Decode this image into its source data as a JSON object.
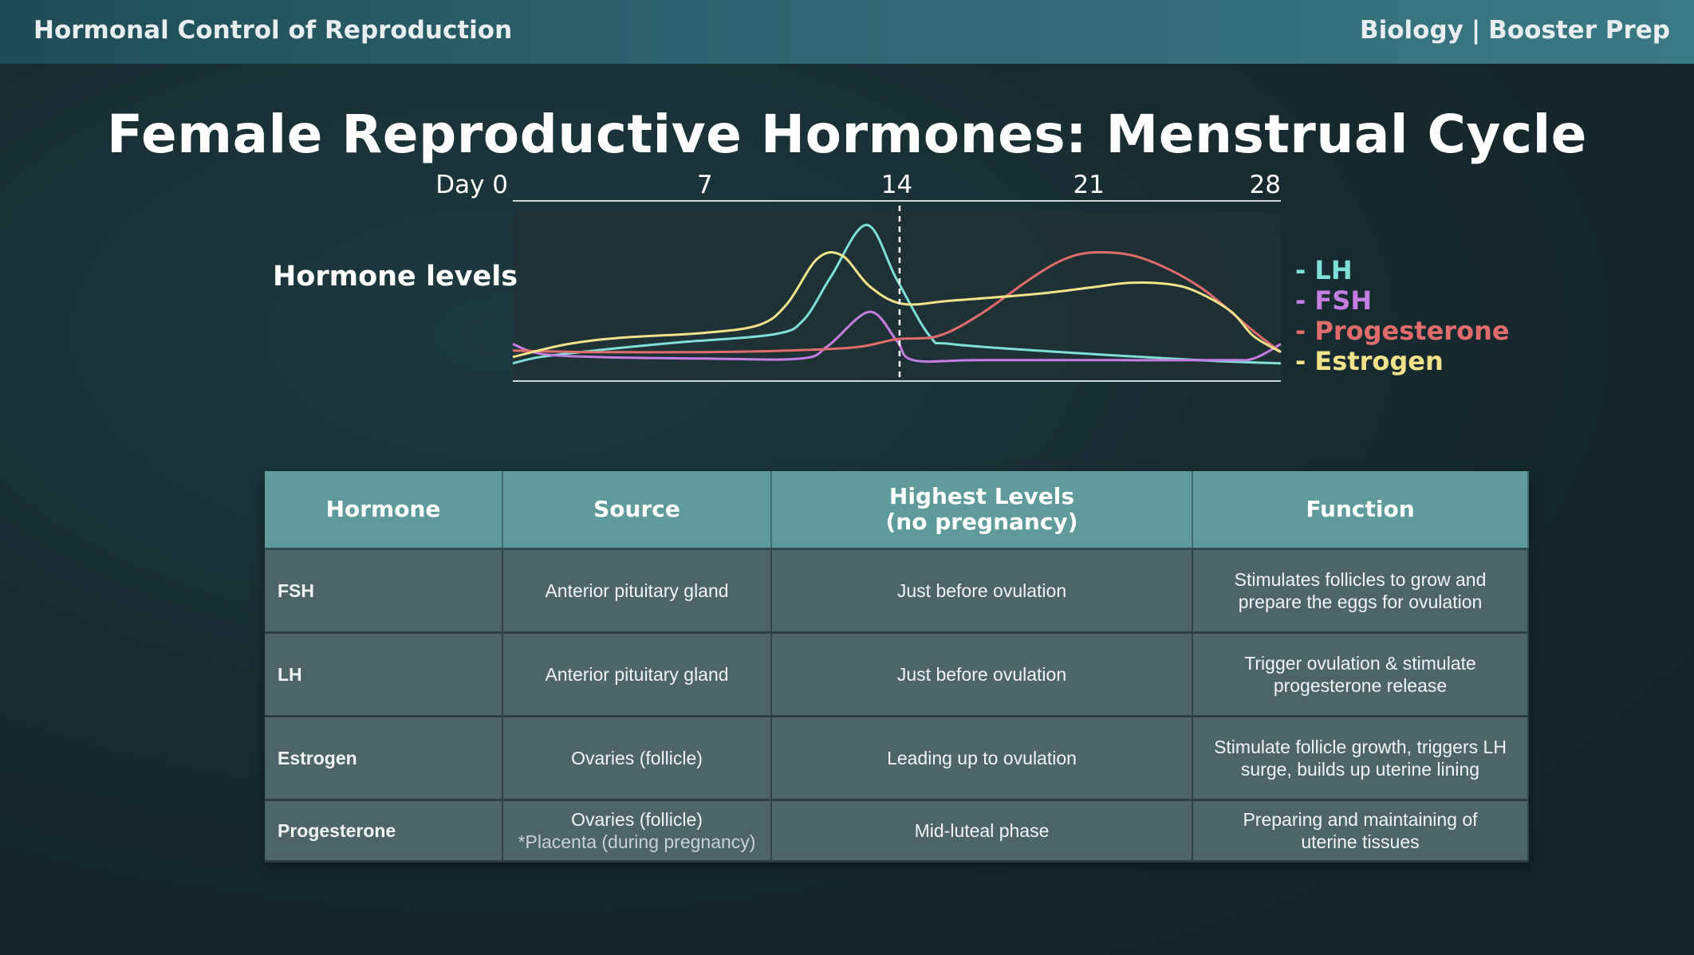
{
  "header": {
    "left_title": "Hormonal Control of Reproduction",
    "subject": "Biology",
    "separator": "|",
    "course": "Booster Prep"
  },
  "slide_title": "Female Reproductive Hormones: Menstrual Cycle",
  "chart_data": {
    "type": "line",
    "title": "",
    "ylabel": "Hormone levels",
    "xlabel": "",
    "xlim": [
      0,
      28
    ],
    "ylim": [
      0,
      100
    ],
    "ticks": [
      {
        "x": 0,
        "label": "Day 0"
      },
      {
        "x": 7,
        "label": "7"
      },
      {
        "x": 14,
        "label": "14"
      },
      {
        "x": 21,
        "label": "21"
      },
      {
        "x": 28,
        "label": "28"
      }
    ],
    "ovulation_marker_day": 14.1,
    "series": [
      {
        "name": "LH",
        "color": "#7ee0d6",
        "points": [
          [
            0,
            8
          ],
          [
            1,
            12
          ],
          [
            3,
            16
          ],
          [
            6,
            21
          ],
          [
            9.5,
            26
          ],
          [
            10.6,
            35
          ],
          [
            11.6,
            62
          ],
          [
            12.9,
            94
          ],
          [
            14,
            60
          ],
          [
            15.2,
            25
          ],
          [
            16,
            20
          ],
          [
            20,
            15
          ],
          [
            25,
            10
          ],
          [
            28,
            8
          ]
        ]
      },
      {
        "name": "FSH",
        "color": "#c47de0",
        "points": [
          [
            0,
            20
          ],
          [
            1,
            14
          ],
          [
            3,
            12
          ],
          [
            7,
            11
          ],
          [
            10.5,
            11
          ],
          [
            11.5,
            19
          ],
          [
            13,
            40
          ],
          [
            14,
            22
          ],
          [
            14.6,
            10
          ],
          [
            17,
            10
          ],
          [
            22,
            10
          ],
          [
            26,
            10
          ],
          [
            27,
            11
          ],
          [
            28,
            20
          ]
        ]
      },
      {
        "name": "Progesterone",
        "color": "#e06c6c",
        "points": [
          [
            0,
            16
          ],
          [
            3,
            15
          ],
          [
            7,
            15
          ],
          [
            10,
            16
          ],
          [
            12.5,
            18
          ],
          [
            14,
            23
          ],
          [
            15.5,
            25
          ],
          [
            17,
            38
          ],
          [
            19,
            62
          ],
          [
            20.3,
            74
          ],
          [
            21.5,
            77
          ],
          [
            23,
            73
          ],
          [
            25,
            56
          ],
          [
            27,
            28
          ],
          [
            28,
            15
          ]
        ]
      },
      {
        "name": "Estrogen",
        "color": "#f2e28a",
        "points": [
          [
            0,
            12
          ],
          [
            2,
            20
          ],
          [
            4,
            24
          ],
          [
            7,
            27
          ],
          [
            9,
            32
          ],
          [
            10,
            45
          ],
          [
            11.1,
            73
          ],
          [
            12,
            75
          ],
          [
            13,
            56
          ],
          [
            14.2,
            45
          ],
          [
            16,
            47
          ],
          [
            19,
            51
          ],
          [
            21,
            55
          ],
          [
            22.5,
            58
          ],
          [
            24,
            57
          ],
          [
            25,
            52
          ],
          [
            26.2,
            40
          ],
          [
            27,
            25
          ],
          [
            28,
            15
          ]
        ]
      }
    ]
  },
  "table": {
    "headers": [
      "Hormone",
      "Source",
      "Highest Levels\n(no pregnancy)",
      "Function"
    ],
    "header_line1": "Highest Levels",
    "header_line2": "(no pregnancy)",
    "rows": [
      {
        "hormone": "FSH",
        "source": "Anterior pituitary gland",
        "source_note": "",
        "highest": "Just before ovulation",
        "function_l1": "Stimulates follicles to grow and",
        "function_l2": "prepare the eggs for ovulation"
      },
      {
        "hormone": "LH",
        "source": "Anterior pituitary gland",
        "source_note": "",
        "highest": "Just before ovulation",
        "function_l1": "Trigger ovulation & stimulate",
        "function_l2": "progesterone release"
      },
      {
        "hormone": "Estrogen",
        "source": "Ovaries (follicle)",
        "source_note": "",
        "highest": "Leading up to ovulation",
        "function_l1": "Stimulate follicle growth, triggers LH",
        "function_l2": "surge, builds up uterine lining"
      },
      {
        "hormone": "Progesterone",
        "source": "Ovaries (follicle)",
        "source_note": "*Placenta (during pregnancy)",
        "highest": "Mid-luteal phase",
        "function_l1": "Preparing and maintaining of",
        "function_l2": "uterine tissues"
      }
    ]
  }
}
